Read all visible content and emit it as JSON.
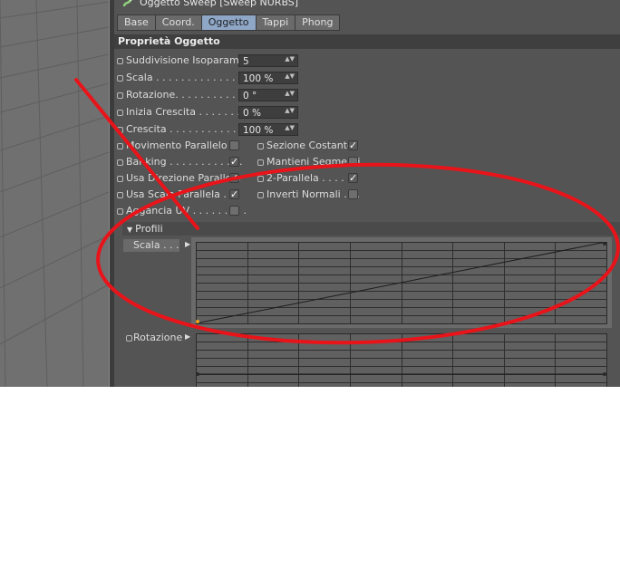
{
  "window": {
    "title": "Oggetto Sweep [Sweep NURBS]"
  },
  "tabs": [
    {
      "label": "Base",
      "active": false
    },
    {
      "label": "Coord.",
      "active": false
    },
    {
      "label": "Oggetto",
      "active": true
    },
    {
      "label": "Tappi",
      "active": false
    },
    {
      "label": "Phong",
      "active": false
    }
  ],
  "section": {
    "title": "Proprietà Oggetto"
  },
  "fields": [
    {
      "label": "Suddivisione Isoparametri",
      "value": "5"
    },
    {
      "label": "Scala . . . . . . . . . . . . . .",
      "value": "100 %"
    },
    {
      "label": "Rotazione. . . . . . . . . . . .",
      "value": "0 °"
    },
    {
      "label": "Inizia Crescita . . . . . . . . .",
      "value": "0 %"
    },
    {
      "label": "Crescita . . . . . . . . . . . . .",
      "value": "100 %"
    }
  ],
  "checks_left": [
    {
      "label": "Movimento Parallelo . .",
      "checked": false
    },
    {
      "label": "Banking . . . . . . . . . . . .",
      "checked": true
    },
    {
      "label": "Usa Direzione Parallela",
      "checked": true
    },
    {
      "label": "Usa Scala Parallela . .",
      "checked": true
    },
    {
      "label": "Aggancia UV . . . . . . . . .",
      "checked": false
    }
  ],
  "checks_right": [
    {
      "label": "Sezione Costante",
      "checked": true
    },
    {
      "label": "Mantieni Segmenti",
      "checked": false
    },
    {
      "label": "2-Parallela . . . . . .",
      "checked": true
    },
    {
      "label": "Inverti Normali . . .",
      "checked": false
    }
  ],
  "profili": {
    "title": "Profili",
    "scala_label": "Scala . . .",
    "rotazione_label": "Rotazione",
    "scala_curve": {
      "start": 0.0,
      "end": 1.0
    },
    "rotazione_curve": {
      "start": 0.5,
      "end": 0.5
    }
  },
  "colors": {
    "accent": "#8fa7c7",
    "annotation": "#e8141a",
    "curve_start_point": "#f0a020"
  },
  "icons": {
    "check": "✓",
    "spin": "▲▼",
    "expand": "▼",
    "collapse": "▶"
  }
}
